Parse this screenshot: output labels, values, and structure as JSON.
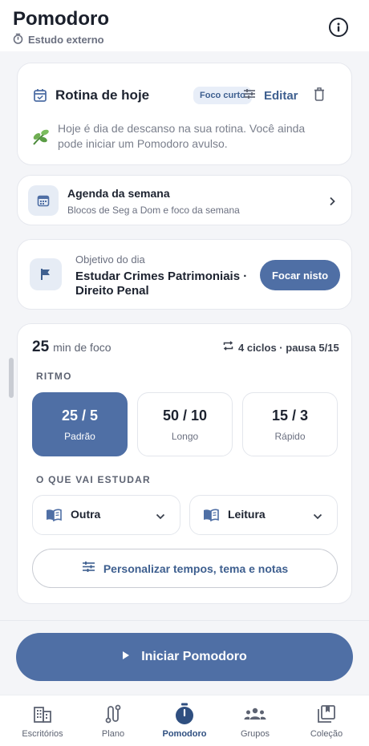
{
  "header": {
    "title": "Pomodoro",
    "subtitle": "Estudo externo"
  },
  "routine": {
    "title": "Rotina de hoje",
    "chip": "Foco curto",
    "edit_label": "Editar",
    "message": "Hoje é dia de descanso na sua rotina. Você ainda pode iniciar um Pomodoro avulso."
  },
  "agenda": {
    "title": "Agenda da semana",
    "subtitle": "Blocos de Seg a Dom e foco da semana"
  },
  "objective": {
    "label": "Objetivo do dia",
    "text": "Estudar Crimes Patrimoniais · Direito Penal",
    "button": "Focar nisto"
  },
  "focus": {
    "minutes": "25",
    "minutes_label": "min de foco",
    "cycles": "4 ciclos · pausa 5/15",
    "rhythm_label": "RITMO",
    "rhythm_options": [
      {
        "value": "25 / 5",
        "label": "Padrão"
      },
      {
        "value": "50 / 10",
        "label": "Longo"
      },
      {
        "value": "15 / 3",
        "label": "Rápido"
      }
    ],
    "selected_rhythm": "25 / 5",
    "study_label": "O QUE VAI ESTUDAR",
    "subject_select": "Outra",
    "activity_select": "Leitura",
    "customize_label": "Personalizar tempos, tema e notas"
  },
  "start_button": "Iniciar Pomodoro",
  "nav": {
    "items": [
      {
        "label": "Escritórios",
        "icon": "building-icon"
      },
      {
        "label": "Plano",
        "icon": "route-icon"
      },
      {
        "label": "Pomodoro",
        "icon": "timer-icon"
      },
      {
        "label": "Grupos",
        "icon": "group-icon"
      },
      {
        "label": "Coleção",
        "icon": "library-icon"
      }
    ],
    "active": "Pomodoro"
  },
  "colors": {
    "accent": "#4f6fa5",
    "accent_dark": "#2f4f80",
    "chip_bg": "#e8eef8",
    "background": "#f4f5f8"
  }
}
